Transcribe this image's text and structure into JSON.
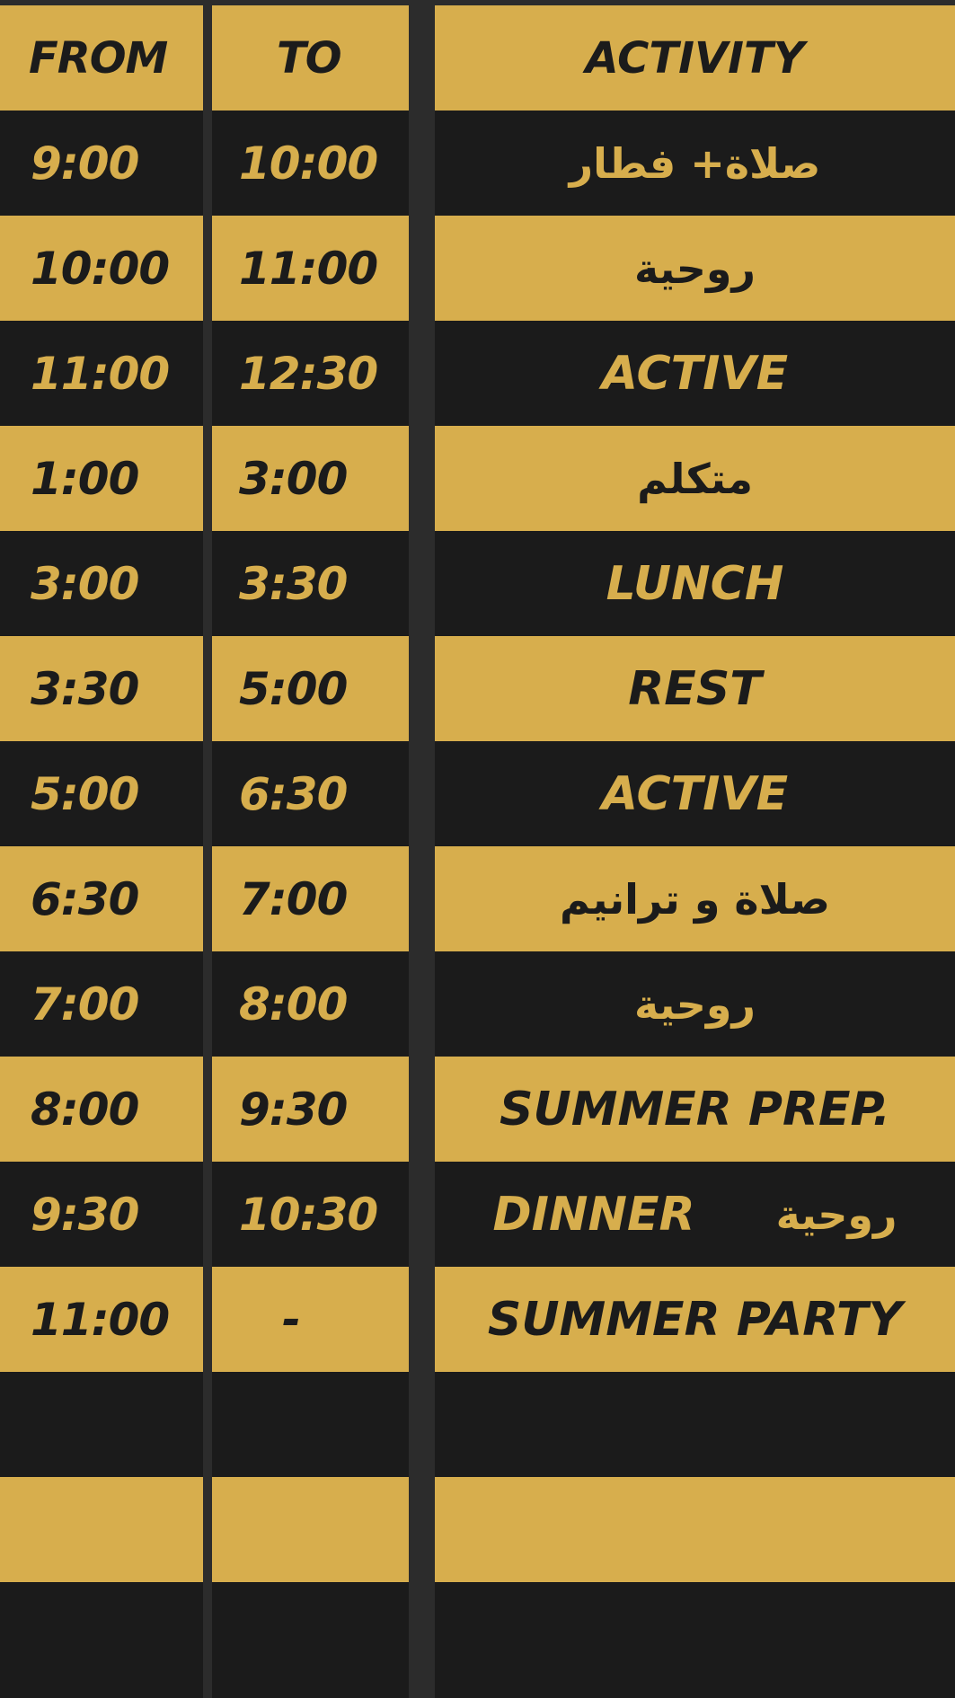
{
  "header": {
    "from": "FROM",
    "to": "TO",
    "activity": "ACTIVITY"
  },
  "rows": [
    {
      "from": "9:00",
      "to": "10:00",
      "activity": "صلاة+ فطار"
    },
    {
      "from": "10:00",
      "to": "11:00",
      "activity": "روحية"
    },
    {
      "from": "11:00",
      "to": "12:30",
      "activity": "ACTIVE"
    },
    {
      "from": "1:00",
      "to": "3:00",
      "activity": "متكلم"
    },
    {
      "from": "3:00",
      "to": "3:30",
      "activity": "LUNCH"
    },
    {
      "from": "3:30",
      "to": "5:00",
      "activity": "REST"
    },
    {
      "from": "5:00",
      "to": "6:30",
      "activity": "ACTIVE"
    },
    {
      "from": "6:30",
      "to": "7:00",
      "activity": "صلاة و ترانيم"
    },
    {
      "from": "7:00",
      "to": "8:00",
      "activity": "روحية"
    },
    {
      "from": "8:00",
      "to": "9:30",
      "activity": "SUMMER PREP."
    },
    {
      "from": "9:30",
      "to": "10:30",
      "activity": "DINNER",
      "activity_extra": "روحية"
    },
    {
      "from": "11:00",
      "to": "-",
      "activity": "SUMMER PARTY"
    },
    {
      "from": "",
      "to": "",
      "activity": ""
    },
    {
      "from": "",
      "to": "",
      "activity": ""
    },
    {
      "from": "",
      "to": "",
      "activity": ""
    }
  ],
  "colors": {
    "gold": "#d7ae4d",
    "dark": "#1b1b1b",
    "divider": "#2c2c2c"
  }
}
